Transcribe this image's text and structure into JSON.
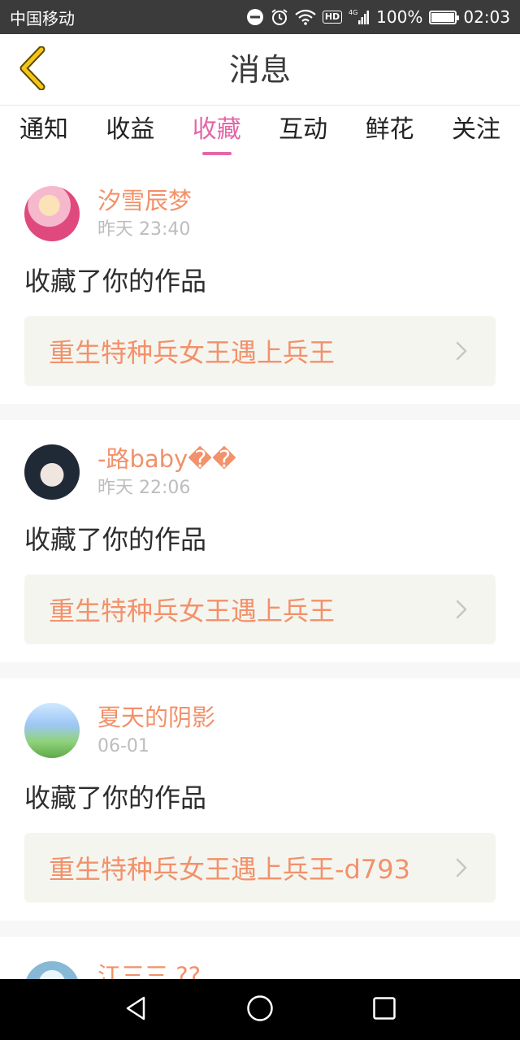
{
  "status_bar": {
    "carrier": "中国移动",
    "network": "4G",
    "hd": "HD",
    "battery_percent": "100%",
    "battery_level": 1.0,
    "time": "02:03"
  },
  "header": {
    "title": "消息"
  },
  "tabs": [
    {
      "label": "通知",
      "active": false
    },
    {
      "label": "收益",
      "active": false
    },
    {
      "label": "收藏",
      "active": true
    },
    {
      "label": "互动",
      "active": false
    },
    {
      "label": "鲜花",
      "active": false
    },
    {
      "label": "关注",
      "active": false
    }
  ],
  "feed": [
    {
      "username": "汐雪辰梦",
      "time": "昨天 23:40",
      "action": "收藏了你的作品",
      "work_title": "重生特种兵女王遇上兵王"
    },
    {
      "username": "-路baby��",
      "time": "昨天 22:06",
      "action": "收藏了你的作品",
      "work_title": "重生特种兵女王遇上兵王"
    },
    {
      "username": "夏天的阴影",
      "time": "06-01",
      "action": "收藏了你的作品",
      "work_title": "重生特种兵女王遇上兵王-d793"
    },
    {
      "username": "江三三 ??",
      "time": "",
      "action": "",
      "work_title": ""
    }
  ],
  "colors": {
    "accent_pink": "#e466a8",
    "username_orange": "#f2916a",
    "back_arrow_yellow": "#f5c518"
  },
  "icons": {
    "back": "chevron-left-icon",
    "item_arrow": "chevron-right-icon",
    "nav_back": "triangle-back-icon",
    "nav_home": "circle-home-icon",
    "nav_recents": "square-recents-icon"
  }
}
